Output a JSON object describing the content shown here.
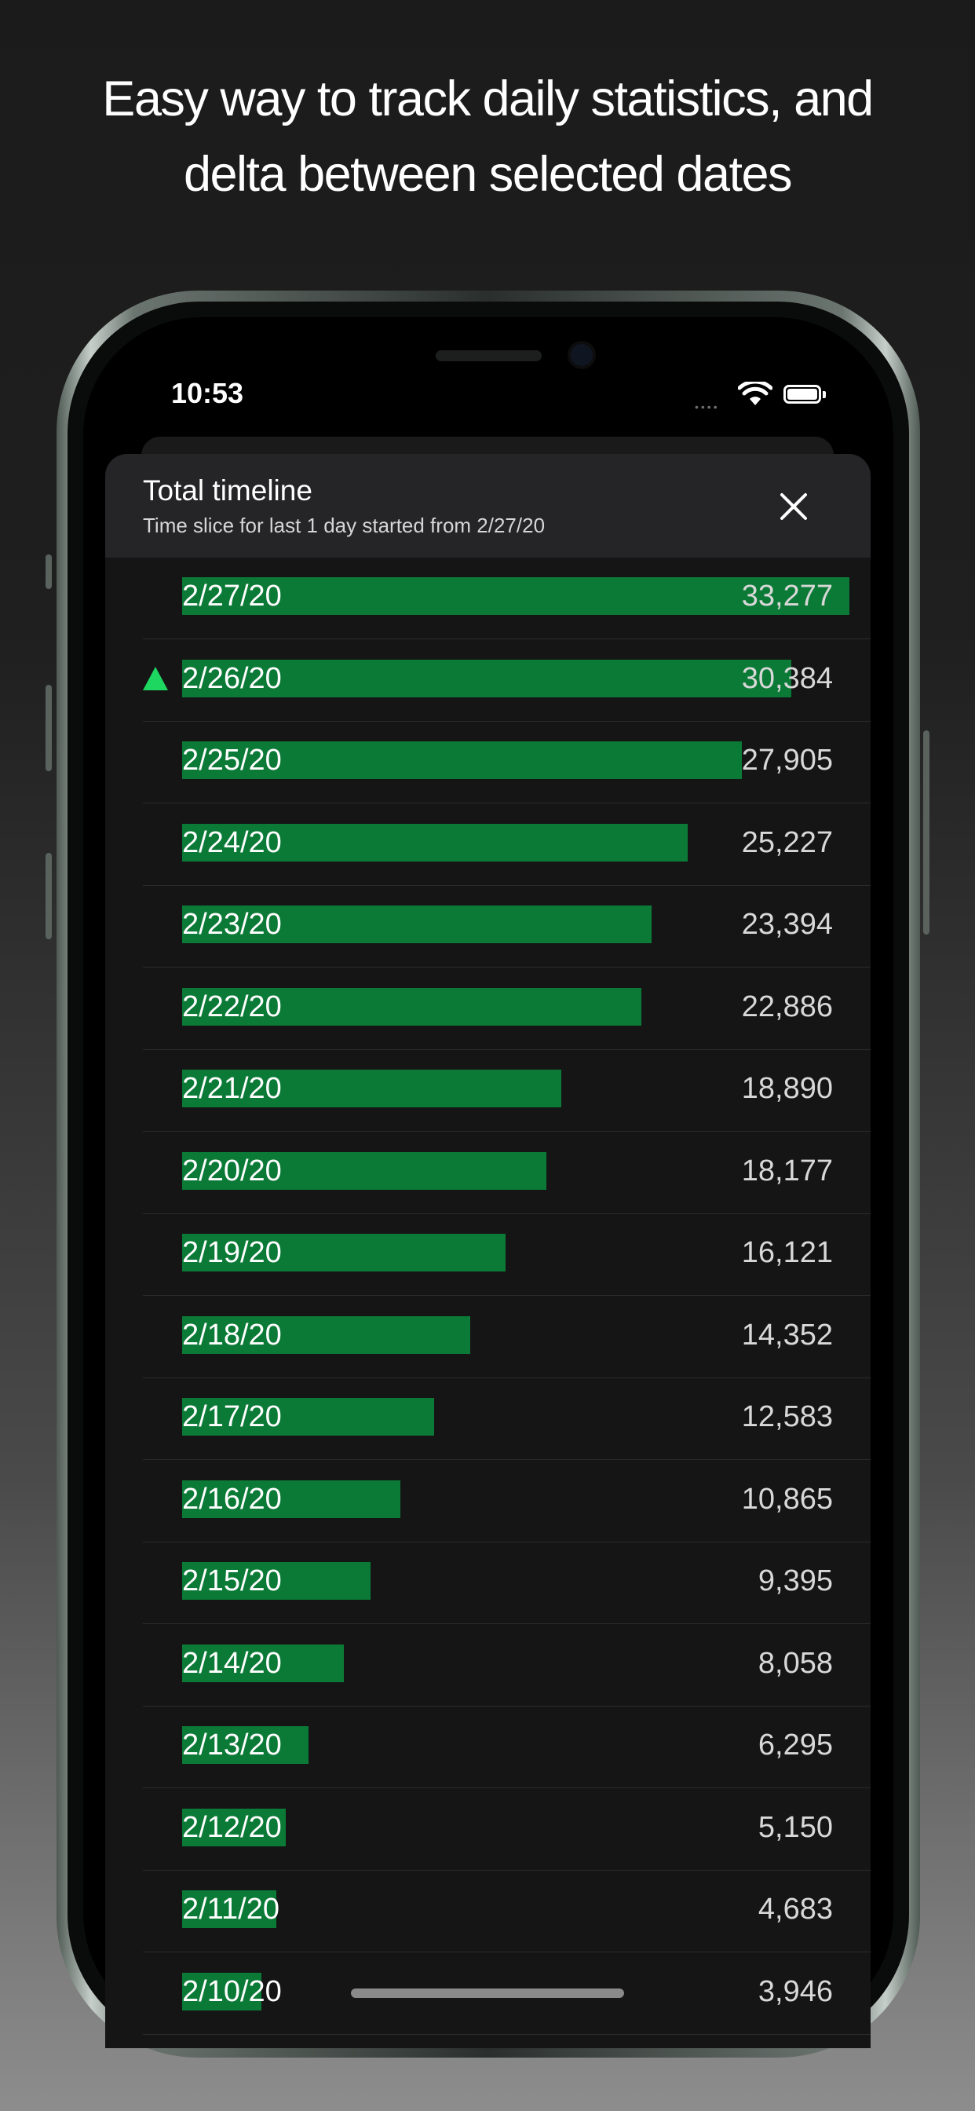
{
  "headline": {
    "line1": "Easy way to track daily statistics, and",
    "line2": "delta between selected dates"
  },
  "status_bar": {
    "time": "10:53"
  },
  "sheet": {
    "title": "Total timeline",
    "subtitle": "Time slice for last 1 day started from 2/27/20"
  },
  "colors": {
    "bar": "#0b7a36",
    "delta_up": "#1ed760",
    "background": "#151516"
  },
  "icons": {
    "close": "close-icon",
    "delta": "triangle-up-icon",
    "wifi": "wifi-icon",
    "battery": "battery-icon"
  },
  "timeline": {
    "max": 33277,
    "rows": [
      {
        "date": "2/27/20",
        "value": "33,277",
        "n": 33277,
        "delta": false
      },
      {
        "date": "2/26/20",
        "value": "30,384",
        "n": 30384,
        "delta": true
      },
      {
        "date": "2/25/20",
        "value": "27,905",
        "n": 27905,
        "delta": false
      },
      {
        "date": "2/24/20",
        "value": "25,227",
        "n": 25227,
        "delta": false
      },
      {
        "date": "2/23/20",
        "value": "23,394",
        "n": 23394,
        "delta": false
      },
      {
        "date": "2/22/20",
        "value": "22,886",
        "n": 22886,
        "delta": false
      },
      {
        "date": "2/21/20",
        "value": "18,890",
        "n": 18890,
        "delta": false
      },
      {
        "date": "2/20/20",
        "value": "18,177",
        "n": 18177,
        "delta": false
      },
      {
        "date": "2/19/20",
        "value": "16,121",
        "n": 16121,
        "delta": false
      },
      {
        "date": "2/18/20",
        "value": "14,352",
        "n": 14352,
        "delta": false
      },
      {
        "date": "2/17/20",
        "value": "12,583",
        "n": 12583,
        "delta": false
      },
      {
        "date": "2/16/20",
        "value": "10,865",
        "n": 10865,
        "delta": false
      },
      {
        "date": "2/15/20",
        "value": "9,395",
        "n": 9395,
        "delta": false
      },
      {
        "date": "2/14/20",
        "value": "8,058",
        "n": 8058,
        "delta": false
      },
      {
        "date": "2/13/20",
        "value": "6,295",
        "n": 6295,
        "delta": false
      },
      {
        "date": "2/12/20",
        "value": "5,150",
        "n": 5150,
        "delta": false
      },
      {
        "date": "2/11/20",
        "value": "4,683",
        "n": 4683,
        "delta": false
      },
      {
        "date": "2/10/20",
        "value": "3,946",
        "n": 3946,
        "delta": false
      }
    ]
  }
}
